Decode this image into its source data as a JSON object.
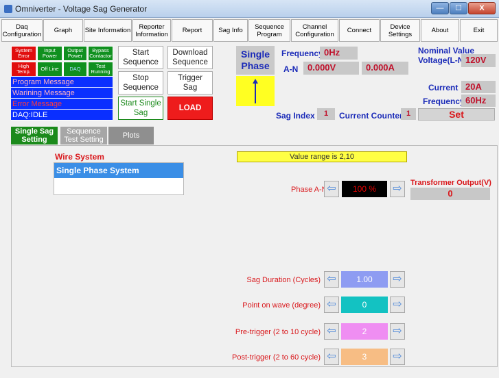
{
  "window": {
    "title": "Omniverter - Voltage Sag Generator",
    "min": "—",
    "max": "☐",
    "close": "X"
  },
  "menu": [
    "Daq\nConfiguration",
    "Graph",
    "Site Information",
    "Reporter\nInformation",
    "Report",
    "Sag Info",
    "Sequence\nProgram",
    "Channel\nConfiguration",
    "Connect",
    "Device\nSettings",
    "About",
    "Exit"
  ],
  "leds": [
    {
      "label": "System\nError",
      "color": "red"
    },
    {
      "label": "Input\nPower",
      "color": "green"
    },
    {
      "label": "Output\nPower",
      "color": "green"
    },
    {
      "label": "Bypass\nContactor",
      "color": "green"
    },
    {
      "label": "High\nTemp.",
      "color": "red"
    },
    {
      "label": "Off Line",
      "color": "green"
    },
    {
      "label": "DAQ",
      "color": "green"
    },
    {
      "label": "Test\nRunning",
      "color": "green"
    }
  ],
  "messages": {
    "program": "Program Message",
    "warning": "Warining Message",
    "error": "Error Message",
    "daq": "DAQ:IDLE"
  },
  "controls": {
    "start_sequence": "Start\nSequence",
    "download_sequence": "Download\nSequence",
    "stop_sequence": "Stop\nSequence",
    "trigger_sag": "Trigger\nSag",
    "start_single_sag": "Start Single\nSag",
    "load": "LOAD"
  },
  "phase": {
    "label": "Single\nPhase"
  },
  "readings": {
    "frequency_label": "Frequency",
    "frequency_value": "0Hz",
    "an_label": "A-N",
    "voltage": "0.000V",
    "current": "0.000A",
    "sag_index_label": "Sag Index",
    "sag_index": "1",
    "current_counter_label": "Current Counter",
    "current_counter": "1"
  },
  "nominal": {
    "title": "Nominal Value\nVoltage(L-N)",
    "voltage": "120V",
    "current_label": "Current",
    "current": "20A",
    "frequency_label": "Frequency",
    "frequency": "60Hz",
    "set": "Set"
  },
  "tabs": [
    "Single Sag\nSetting",
    "Sequence\nTest Setting",
    "Plots"
  ],
  "wire": {
    "title": "Wire System",
    "selected": "Single Phase System"
  },
  "range_note": "Value range is 2,10",
  "phase_an": {
    "label": "Phase A-N",
    "value": "100 %"
  },
  "transformer": {
    "label": "Transformer Output(V)",
    "value": "0"
  },
  "params": [
    {
      "label": "Sag Duration (Cycles)",
      "value": "1.00",
      "color": "#8e9cf2"
    },
    {
      "label": "Point on wave (degree)",
      "value": "0",
      "color": "#13c2c2"
    },
    {
      "label": "Pre-trigger (2 to 10 cycle)",
      "value": "2",
      "color": "#ef8ef2"
    },
    {
      "label": "Post-trigger (2 to 60 cycle)",
      "value": "3",
      "color": "#f7bd84"
    }
  ]
}
